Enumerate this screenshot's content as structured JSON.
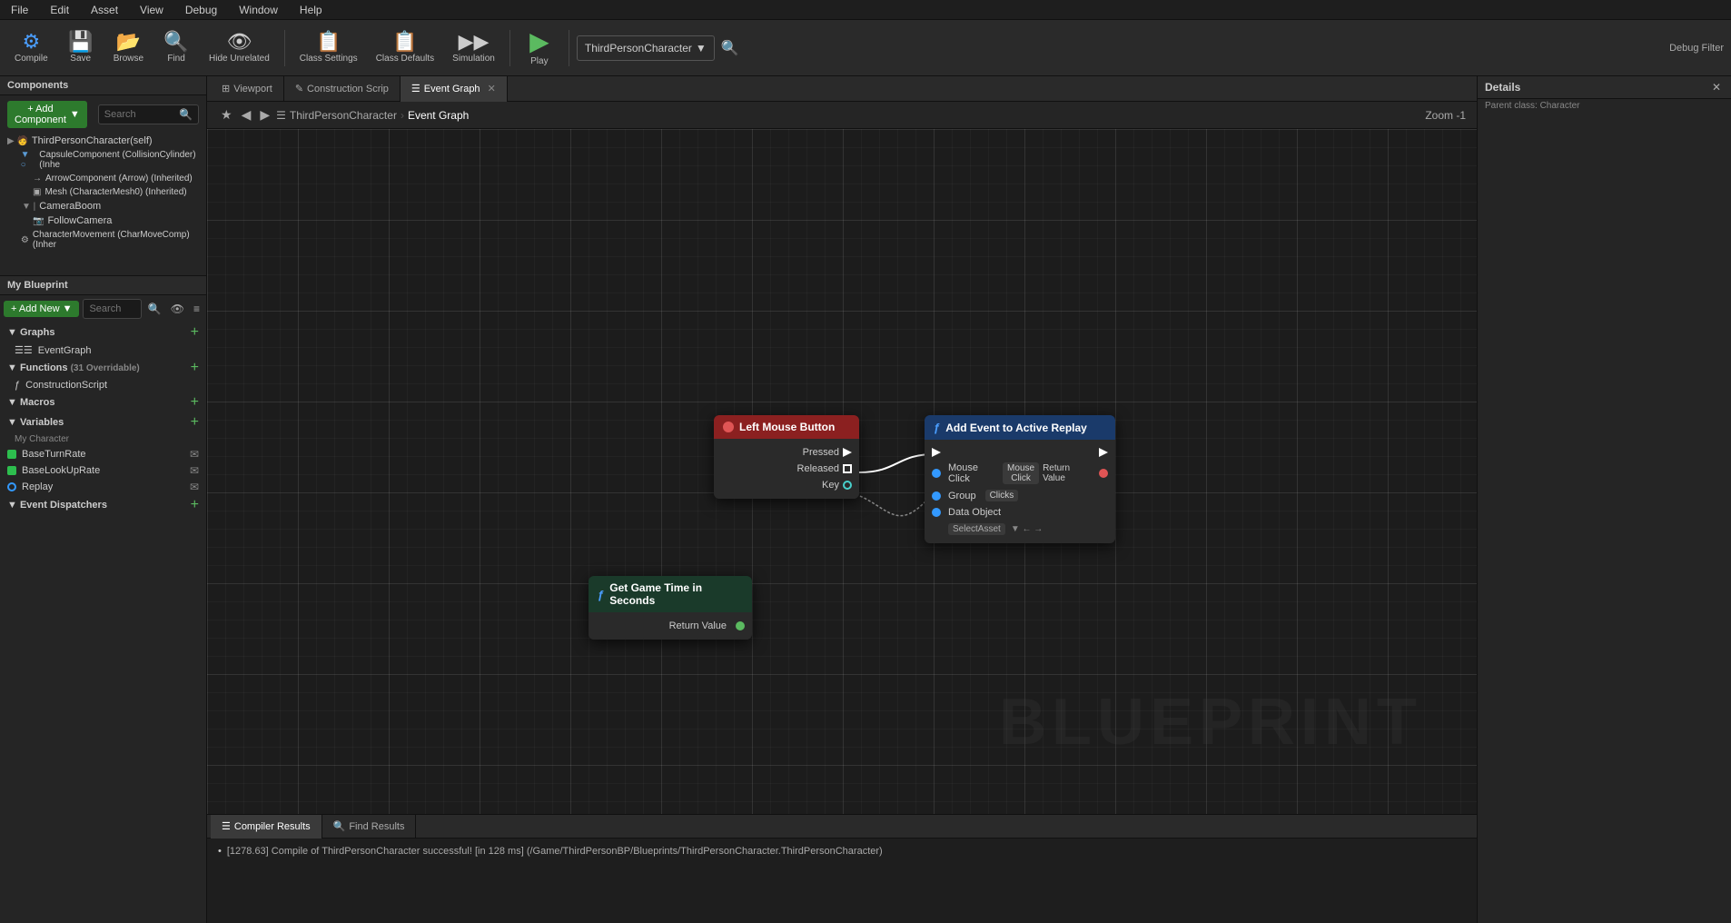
{
  "menubar": {
    "items": [
      "File",
      "Edit",
      "Asset",
      "View",
      "Debug",
      "Window",
      "Help"
    ]
  },
  "toolbar": {
    "compile_label": "Compile",
    "save_label": "Save",
    "browse_label": "Browse",
    "find_label": "Find",
    "hide_unrelated_label": "Hide Unrelated",
    "class_settings_label": "Class Settings",
    "class_defaults_label": "Class Defaults",
    "simulation_label": "Simulation",
    "play_label": "Play",
    "search_placeholder": "Search",
    "blueprint_class": "ThirdPersonCharacter",
    "debug_filter": "Debug Filter"
  },
  "tabs": {
    "viewport": "Viewport",
    "construction_script": "Construction Scrip",
    "event_graph": "Event Graph"
  },
  "breadcrumb": {
    "class": "ThirdPersonCharacter",
    "graph": "Event Graph",
    "zoom": "Zoom -1"
  },
  "components_panel": {
    "title": "Components",
    "add_btn": "+ Add Component",
    "search_placeholder": "Search",
    "items": [
      {
        "label": "ThirdPersonCharacter(self)",
        "level": 0,
        "icon": "person"
      },
      {
        "label": "CapsuleComponent (CollisionCylinder) (Inhe",
        "level": 1,
        "icon": "capsule"
      },
      {
        "label": "ArrowComponent (Arrow) (Inherited)",
        "level": 2,
        "icon": "arrow"
      },
      {
        "label": "Mesh (CharacterMesh0) (Inherited)",
        "level": 2,
        "icon": "mesh"
      },
      {
        "label": "CameraBoom",
        "level": 1,
        "icon": "camera"
      },
      {
        "label": "FollowCamera",
        "level": 2,
        "icon": "camera"
      },
      {
        "label": "CharacterMovement (CharMoveComp) (Inher",
        "level": 1,
        "icon": "char"
      }
    ]
  },
  "blueprint_panel": {
    "title": "My Blueprint",
    "add_new_label": "+ Add New",
    "search_placeholder": "Search",
    "sections": {
      "graphs": {
        "label": "Graphs",
        "items": [
          "EventGraph"
        ]
      },
      "functions": {
        "label": "Functions",
        "count": "31 Overridable",
        "items": [
          "ConstructionScript"
        ]
      },
      "macros": {
        "label": "Macros",
        "items": []
      },
      "variables": {
        "label": "Variables",
        "items": [
          {
            "name": "My Character",
            "type": "section"
          },
          {
            "name": "BaseTurnRate",
            "type": "float"
          },
          {
            "name": "BaseLookUpRate",
            "type": "float"
          },
          {
            "name": "Replay",
            "type": "replay"
          }
        ]
      },
      "event_dispatchers": {
        "label": "Event Dispatchers",
        "items": []
      }
    }
  },
  "nodes": {
    "lmb": {
      "title": "Left Mouse Button",
      "pins_out": [
        "Pressed",
        "Released",
        "Key"
      ]
    },
    "add_event": {
      "title": "Add Event to Active Replay",
      "event_name": "Mouse Click",
      "group": "Clicks",
      "data_object_label": "Data Object",
      "data_object_value": "SelectAsset",
      "return_value_label": "Return Value"
    },
    "gametime": {
      "title": "Get Game Time in Seconds",
      "return_value": "Return Value"
    }
  },
  "bottom_panel": {
    "tabs": [
      "Compiler Results",
      "Find Results"
    ],
    "log_message": "[1278.63] Compile of ThirdPersonCharacter successful! [in 128 ms] (/Game/ThirdPersonBP/Blueprints/ThirdPersonCharacter.ThirdPersonCharacter)"
  },
  "right_panel": {
    "title": "Details",
    "parent_class": "Parent class: Character"
  },
  "watermark": "BLUEPRINT"
}
